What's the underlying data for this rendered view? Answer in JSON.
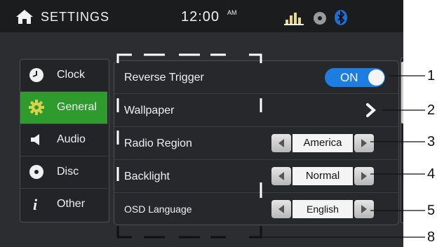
{
  "topbar": {
    "title": "SETTINGS",
    "time": "12:00",
    "ampm": "AM",
    "icons": [
      "home-icon",
      "equalizer-icon",
      "disc-icon",
      "bluetooth-icon"
    ]
  },
  "sidebar": {
    "items": [
      {
        "label": "Clock",
        "icon": "clock-icon",
        "active": false
      },
      {
        "label": "General",
        "icon": "gear-icon",
        "active": true
      },
      {
        "label": "Audio",
        "icon": "speaker-icon",
        "active": false
      },
      {
        "label": "Disc",
        "icon": "disc-icon",
        "active": false
      },
      {
        "label": "Other",
        "icon": "info-icon",
        "active": false
      }
    ]
  },
  "settings": {
    "rows": [
      {
        "label": "Reverse Trigger",
        "control": "toggle",
        "value": "ON"
      },
      {
        "label": "Wallpaper",
        "control": "chevron"
      },
      {
        "label": "Radio Region",
        "control": "selector",
        "value": "America"
      },
      {
        "label": "Backlight",
        "control": "selector",
        "value": "Normal"
      },
      {
        "label": "OSD Language",
        "control": "selector",
        "value": "English"
      }
    ]
  },
  "callouts": [
    "1",
    "2",
    "3",
    "4",
    "5",
    "8"
  ],
  "colors": {
    "active_item": "#2f9b2f",
    "toggle_on": "#1e7de0",
    "background": "#2c2d30"
  }
}
